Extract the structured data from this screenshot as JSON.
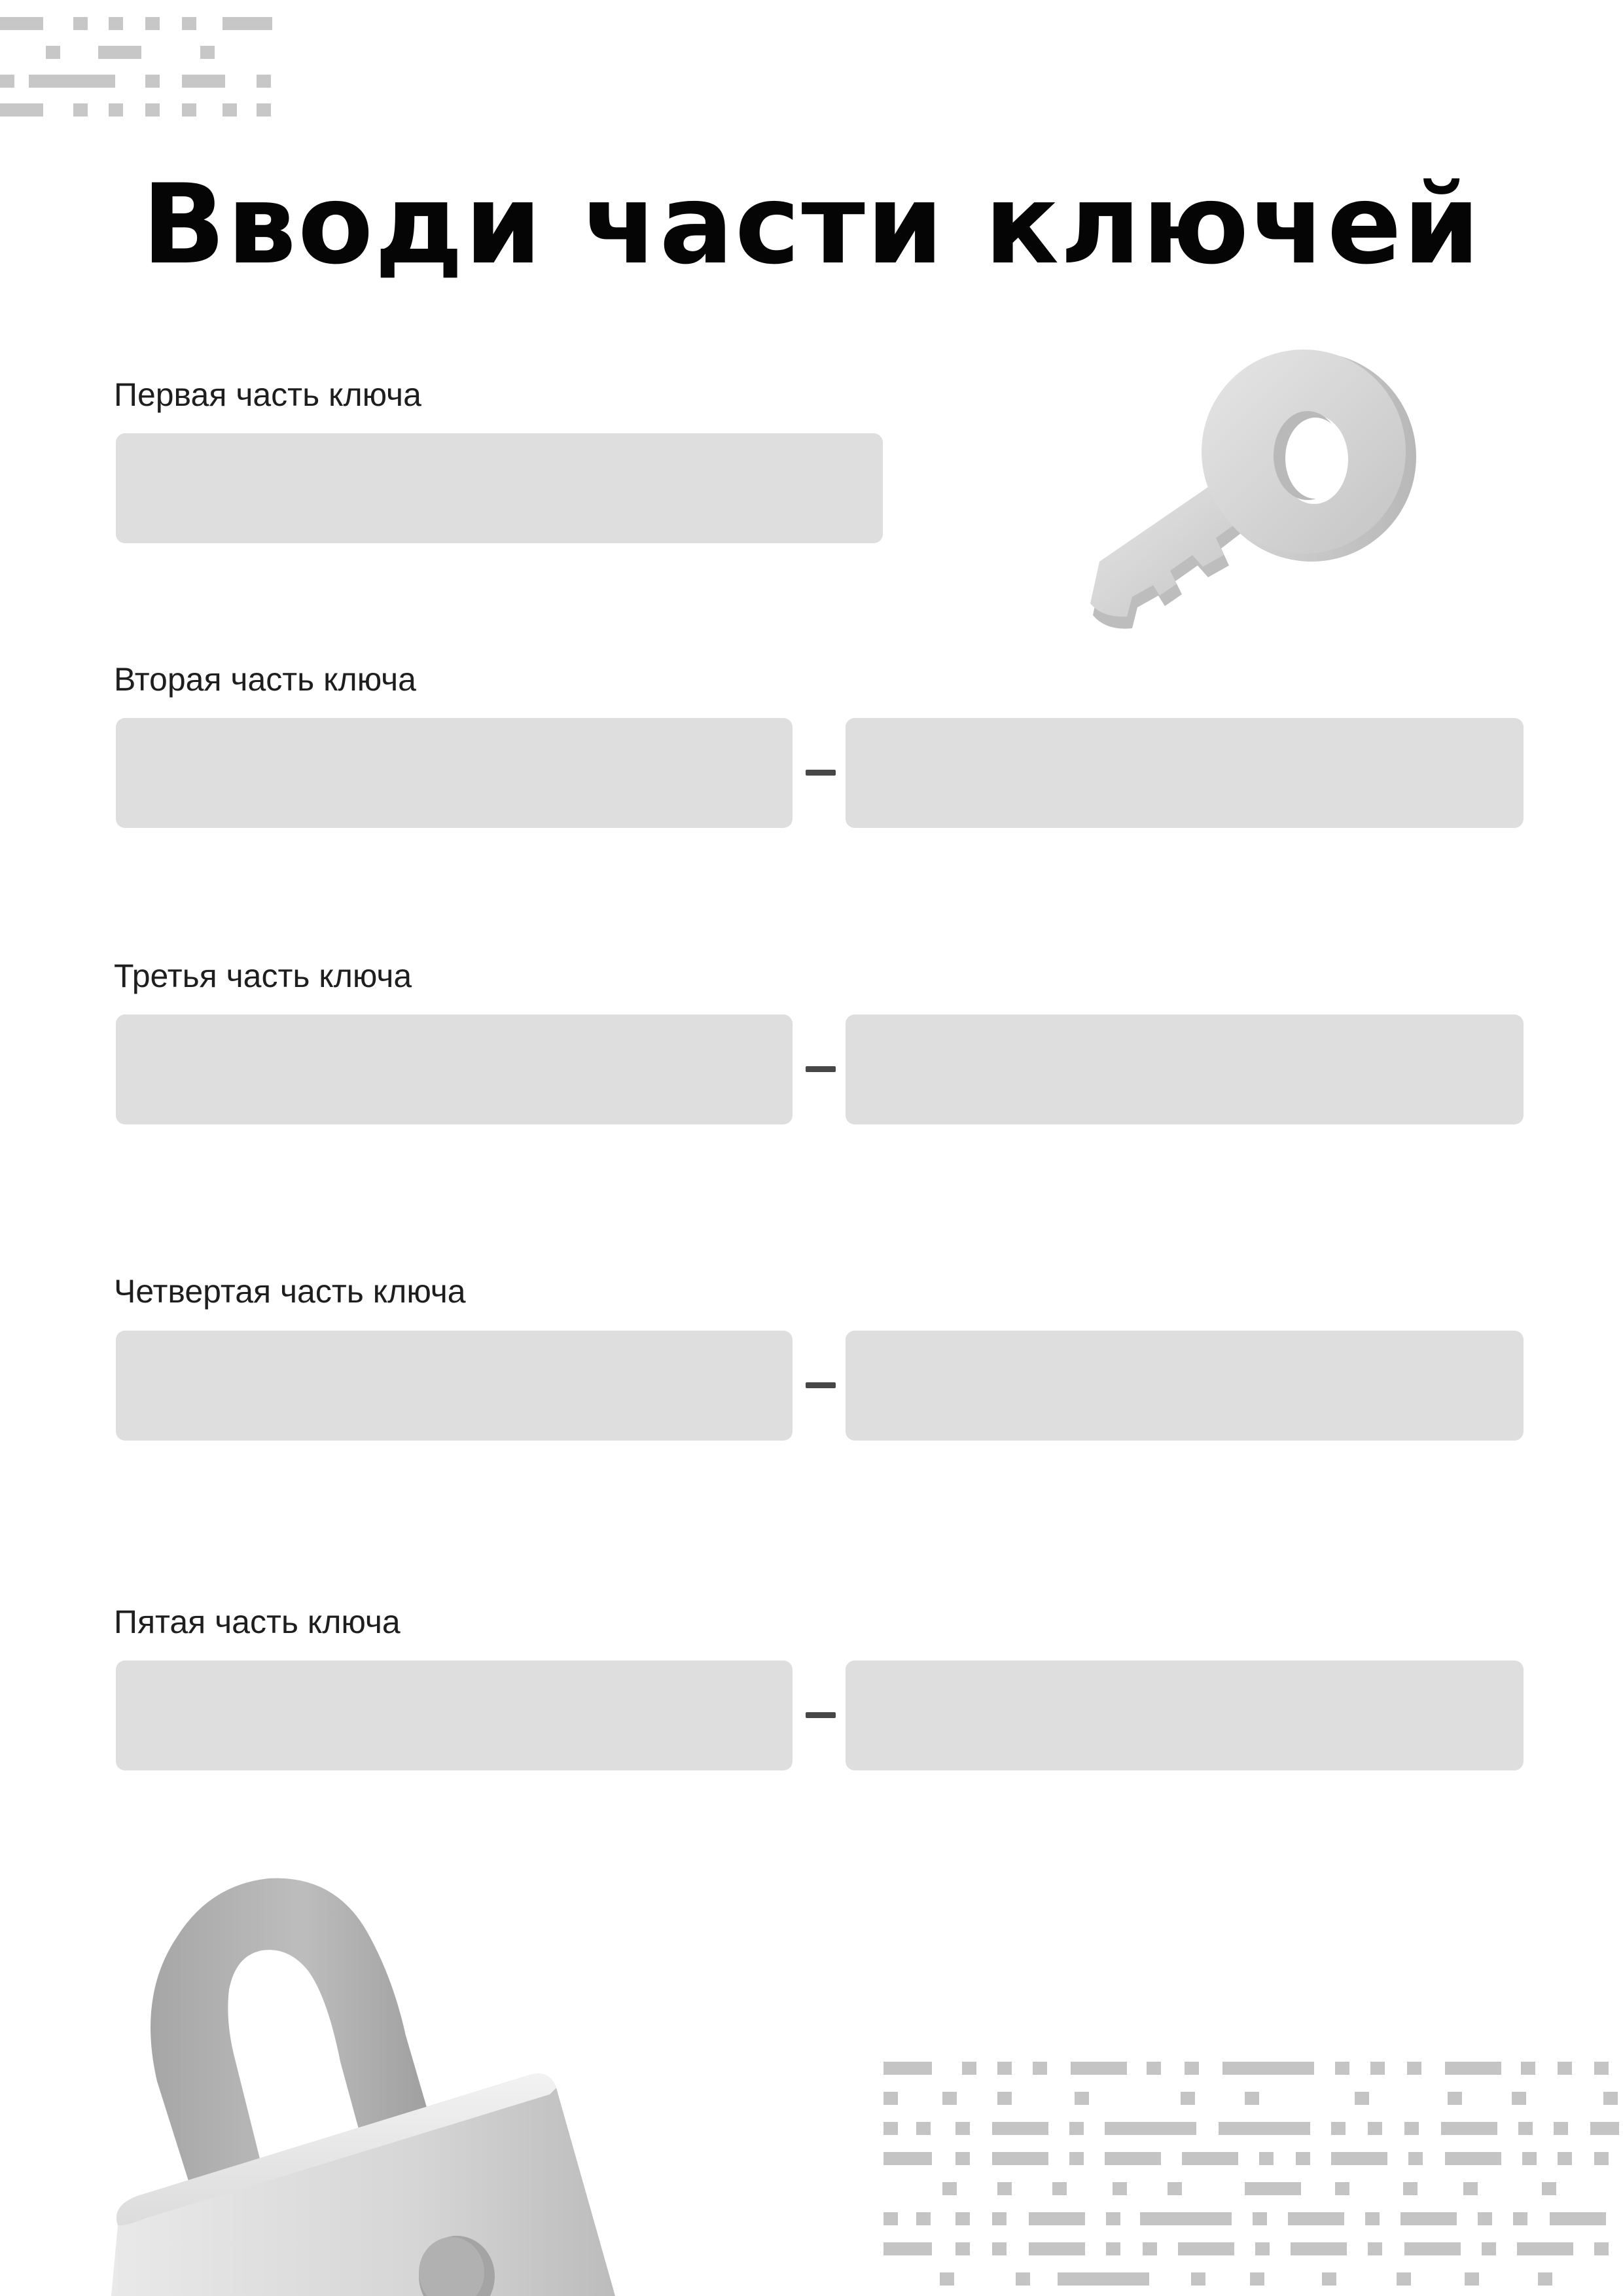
{
  "title": "Вводи части ключей",
  "sections": [
    {
      "label": "Первая часть ключа"
    },
    {
      "label": "Вторая часть ключа"
    },
    {
      "label": "Третья часть ключа"
    },
    {
      "label": "Четвертая часть ключа"
    },
    {
      "label": "Пятая часть ключа"
    }
  ],
  "colors": {
    "field_fill": "#dedede",
    "dash": "#474747",
    "pattern": "#c4c4c4",
    "title": "#050505"
  },
  "icons": {
    "top_left_pattern": "dot-dash-pattern-icon",
    "key": "key-icon",
    "padlock": "padlock-icon",
    "bottom_right_pattern": "dot-dash-pattern-icon"
  }
}
